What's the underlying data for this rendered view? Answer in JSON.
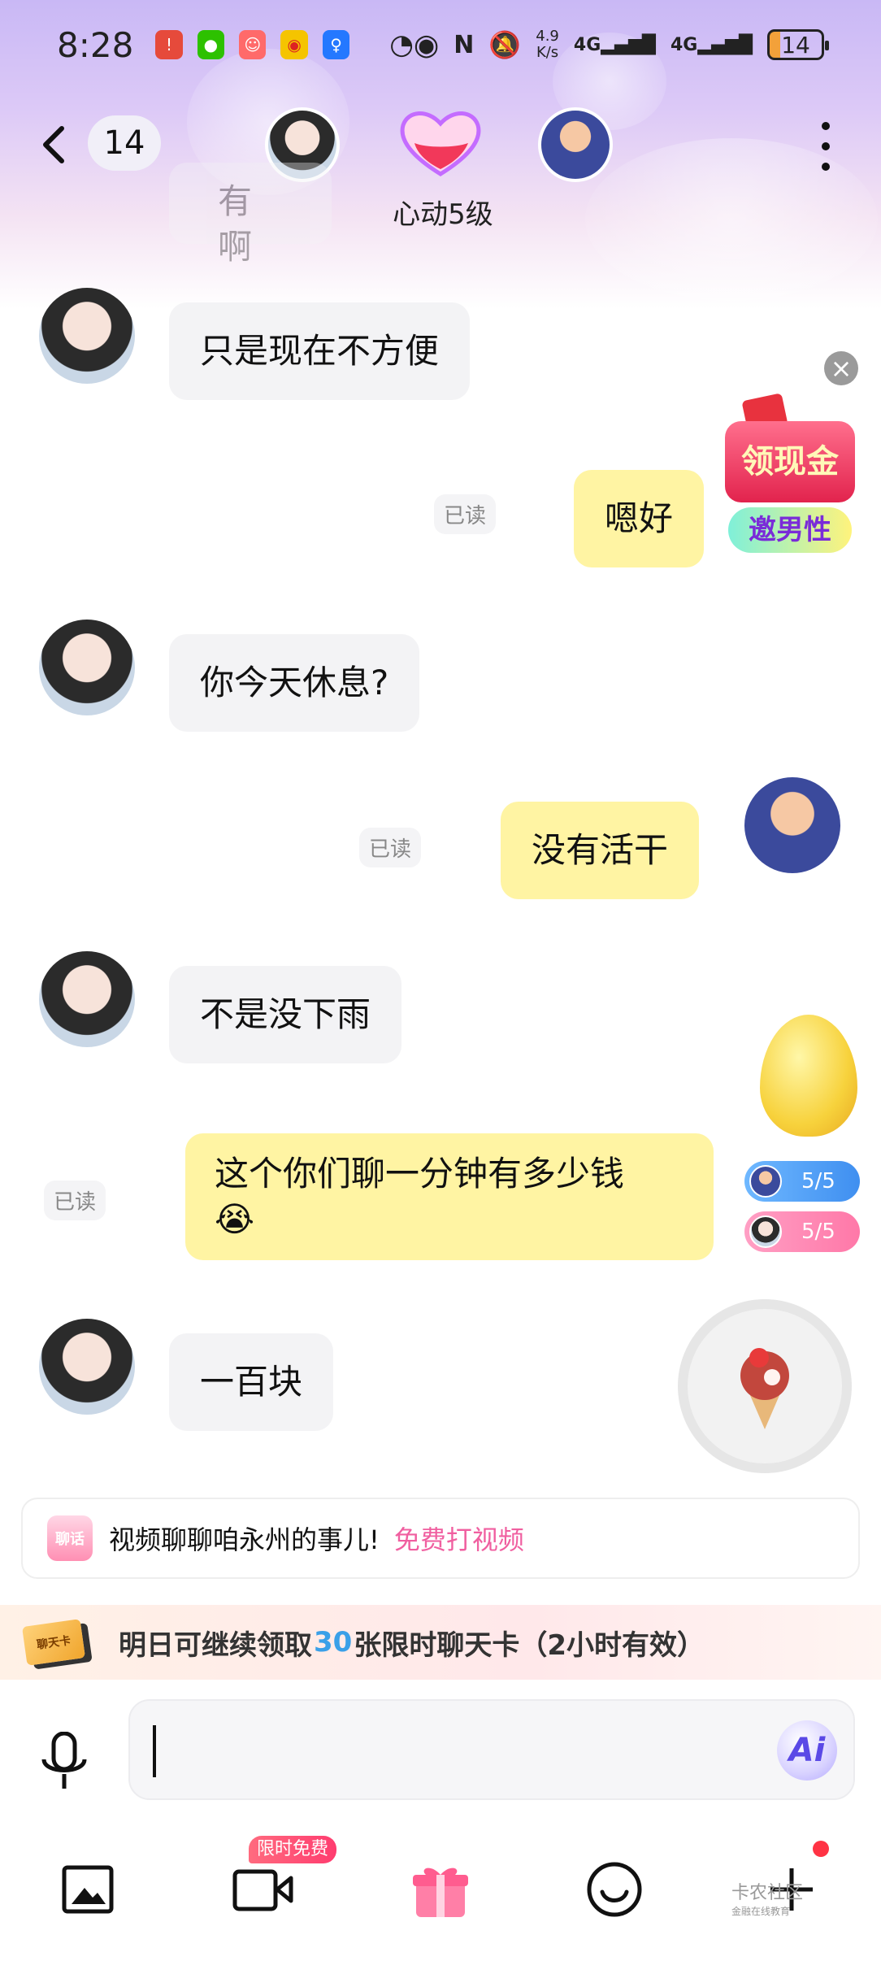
{
  "status_bar": {
    "time": "8:28",
    "speed_top": "4.9",
    "speed_bottom": "K/s",
    "signal1": "4G",
    "signal2": "4G",
    "battery": "14"
  },
  "header": {
    "back_icon": "chevron-left-icon",
    "unread_count": "14",
    "intimacy_level": "心动5级"
  },
  "messages": [
    {
      "from": "them",
      "text": "有啊"
    },
    {
      "from": "them",
      "text": "只是现在不方便"
    },
    {
      "from": "me",
      "text": "嗯好",
      "read": "已读"
    },
    {
      "from": "them",
      "text": "你今天休息?"
    },
    {
      "from": "me",
      "text": "没有活干",
      "read": "已读"
    },
    {
      "from": "them",
      "text": "不是没下雨"
    },
    {
      "from": "me",
      "text": "这个你们聊一分钟有多少钱",
      "emoji": "😭",
      "read": "已读"
    },
    {
      "from": "them",
      "text": "一百块"
    }
  ],
  "promo": {
    "cash": "领现金",
    "invite": "邀男性"
  },
  "counters": {
    "me": "5/5",
    "them": "5/5"
  },
  "suggestion": {
    "icon_text": "聊话",
    "text": "视频聊聊咱永州的事儿!",
    "link": "免费打视频"
  },
  "chat_card": {
    "ticket_text": "聊天卡",
    "prefix": "明日可继续领取",
    "count": "30",
    "suffix": "张限时聊天卡（2小时有效）"
  },
  "input": {
    "ai_label": "Ai"
  },
  "toolbar": {
    "free_badge": "限时免费",
    "icons": [
      "image-icon",
      "video-icon",
      "gift-icon",
      "emoji-icon",
      "plus-icon"
    ]
  },
  "watermark": {
    "title": "卡农社区",
    "subtitle": "金融在线教育"
  },
  "colors": {
    "incoming_bubble": "#f3f3f5",
    "outgoing_bubble": "#fff4a3",
    "accent_pink": "#f05fa0",
    "accent_blue": "#3aa0e8"
  }
}
